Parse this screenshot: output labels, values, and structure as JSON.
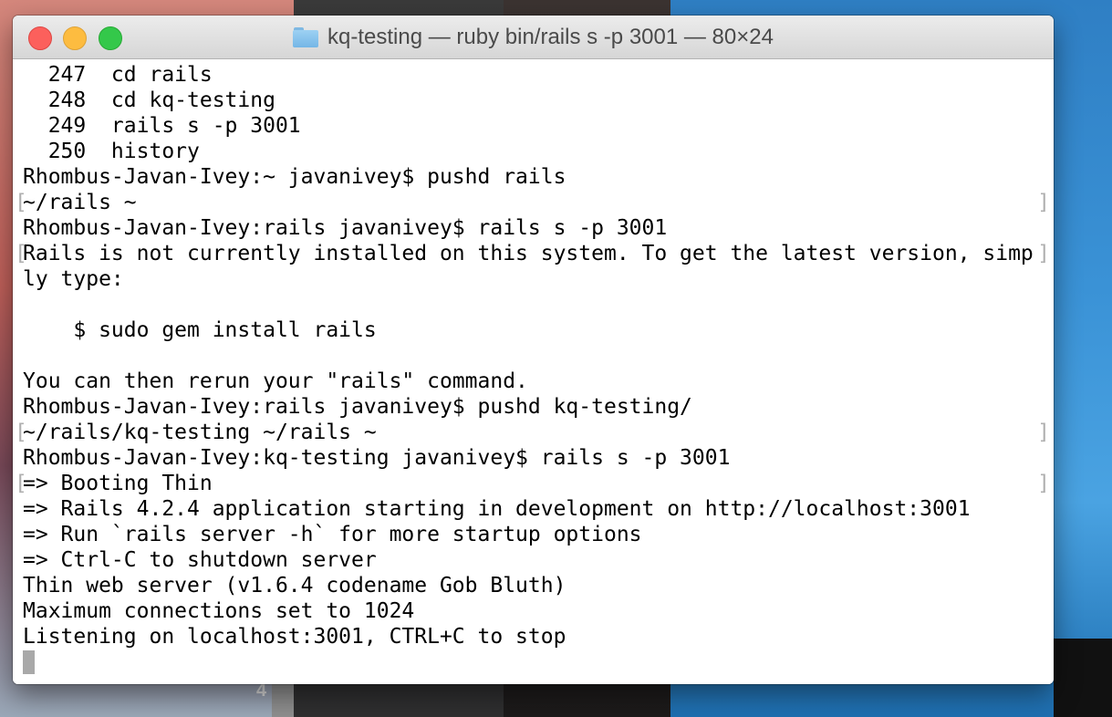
{
  "window": {
    "title": "kq-testing — ruby bin/rails s -p 3001 — 80×24",
    "traffic_lights": [
      "close",
      "minimize",
      "zoom"
    ]
  },
  "desktop": {
    "badge_number": "4"
  },
  "terminal": {
    "lines": [
      "  247  cd rails",
      "  248  cd kq-testing",
      "  249  rails s -p 3001",
      "  250  history",
      "Rhombus-Javan-Ivey:~ javanivey$ pushd rails",
      "~/rails ~",
      "Rhombus-Javan-Ivey:rails javanivey$ rails s -p 3001",
      "Rails is not currently installed on this system. To get the latest version, simp",
      "ly type:",
      "",
      "    $ sudo gem install rails",
      "",
      "You can then rerun your \"rails\" command.",
      "Rhombus-Javan-Ivey:rails javanivey$ pushd kq-testing/",
      "~/rails/kq-testing ~/rails ~",
      "Rhombus-Javan-Ivey:kq-testing javanivey$ rails s -p 3001",
      "=> Booting Thin",
      "=> Rails 4.2.4 application starting in development on http://localhost:3001",
      "=> Run `rails server -h` for more startup options",
      "=> Ctrl-C to shutdown server",
      "Thin web server (v1.6.4 codename Gob Bluth)",
      "Maximum connections set to 1024",
      "Listening on localhost:3001, CTRL+C to stop"
    ],
    "bracket_left": "[",
    "bracket_right": "]"
  },
  "icons": {
    "folder": "folder-icon",
    "cursor": "block-cursor"
  }
}
